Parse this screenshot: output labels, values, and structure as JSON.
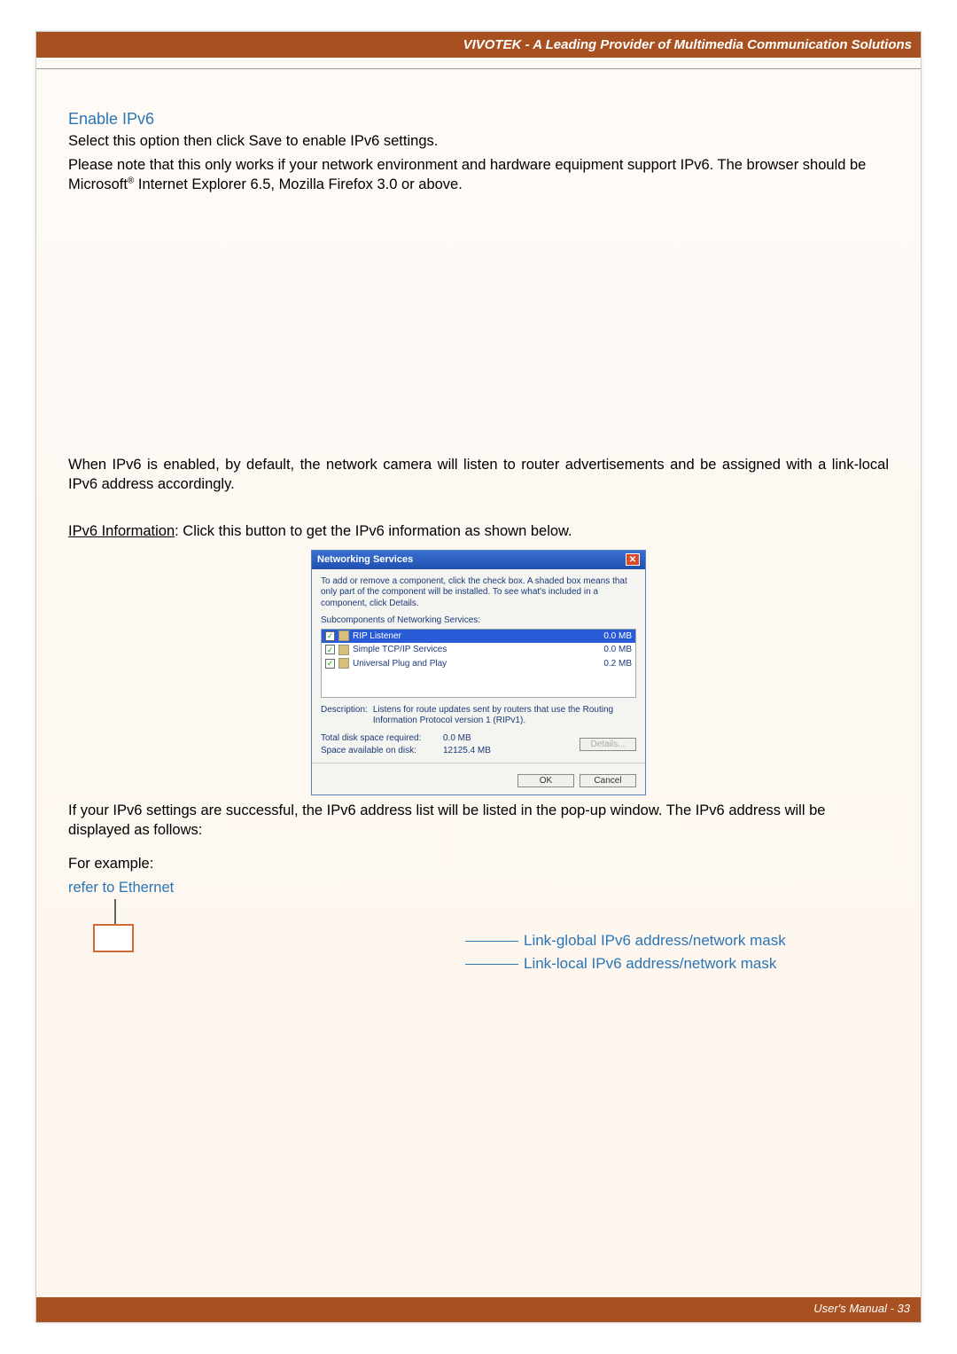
{
  "header": {
    "brand": "VIVOTEK - A Leading Provider of Multimedia Communication Solutions"
  },
  "section": {
    "title": "Enable IPv6",
    "p1": "Select this option then click Save to enable IPv6 settings.",
    "p2a": "Please note that this only works if your network environment and hardware equipment support IPv6. The browser should be Microsoft",
    "p2sup": "®",
    "p2b": " Internet Explorer 6.5, Mozilla Firefox 3.0 or above.",
    "p3": "When IPv6 is enabled, by default, the network camera will listen to router advertisements and be assigned with a link-local IPv6 address accordingly.",
    "p4_label": "IPv6 Information",
    "p4_rest": ": Click this button to get the IPv6 information as shown below.",
    "p5": "If your IPv6 settings are successful, the IPv6 address list will be listed in the pop-up window. The IPv6 address will be displayed as follows:",
    "example_label": "For example:",
    "refer_eth": "refer to Ethernet",
    "annot_global": "Link-global IPv6 address/network mask",
    "annot_local": "Link-local IPv6 address/network mask"
  },
  "dialog": {
    "title": "Networking Services",
    "intro": "To add or remove a component, click the check box. A shaded box means that only part of the component will be installed. To see what's included in a component, click Details.",
    "sub_label": "Subcomponents of Networking Services:",
    "items": [
      {
        "checked": true,
        "selected": true,
        "name": "RIP Listener",
        "size": "0.0 MB"
      },
      {
        "checked": true,
        "selected": false,
        "name": "Simple TCP/IP Services",
        "size": "0.0 MB"
      },
      {
        "checked": true,
        "selected": false,
        "name": "Universal Plug and Play",
        "size": "0.2 MB"
      }
    ],
    "desc_label": "Description:",
    "desc_text": "Listens for route updates sent by routers that use the Routing Information Protocol version 1 (RIPv1).",
    "disk_req_label": "Total disk space required:",
    "disk_req_value": "0.0 MB",
    "disk_avail_label": "Space available on disk:",
    "disk_avail_value": "12125.4 MB",
    "details_btn": "Details...",
    "ok_btn": "OK",
    "cancel_btn": "Cancel"
  },
  "footer": {
    "text": "User's Manual - 33"
  }
}
